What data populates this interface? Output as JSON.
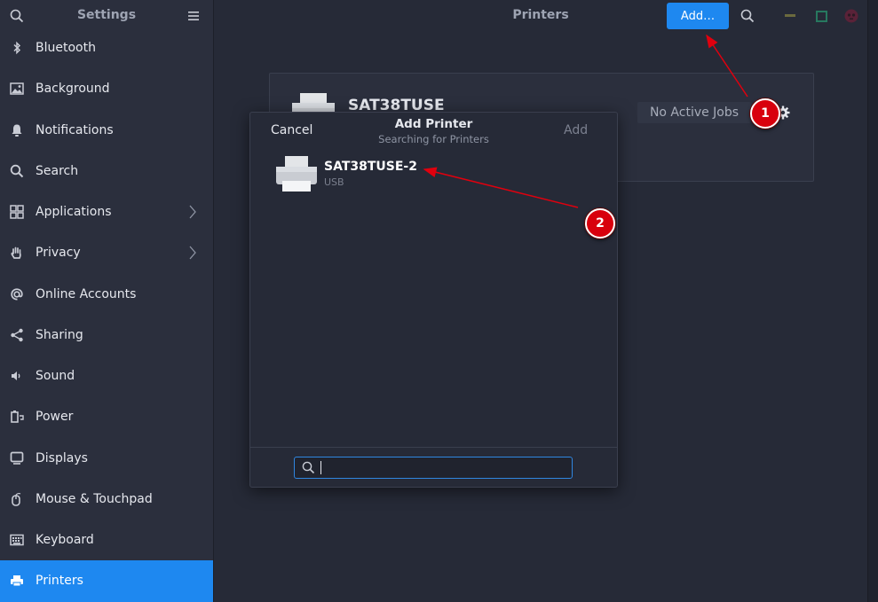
{
  "sidebar": {
    "title": "Settings",
    "search_icon": "search-icon",
    "menu_icon": "hamburger-menu-icon",
    "items": [
      {
        "label": "Bluetooth",
        "icon": "bluetooth-icon"
      },
      {
        "label": "Background",
        "icon": "image-icon"
      },
      {
        "label": "Notifications",
        "icon": "bell-icon"
      },
      {
        "label": "Search",
        "icon": "search-icon"
      },
      {
        "label": "Applications",
        "icon": "grid-icon",
        "has_submenu": true
      },
      {
        "label": "Privacy",
        "icon": "hand-icon",
        "has_submenu": true
      },
      {
        "label": "Online Accounts",
        "icon": "at-sign-icon"
      },
      {
        "label": "Sharing",
        "icon": "share-icon"
      },
      {
        "label": "Sound",
        "icon": "speaker-icon"
      },
      {
        "label": "Power",
        "icon": "power-icon"
      },
      {
        "label": "Displays",
        "icon": "monitor-icon"
      },
      {
        "label": "Mouse & Touchpad",
        "icon": "mouse-icon"
      },
      {
        "label": "Keyboard",
        "icon": "keyboard-icon"
      },
      {
        "label": "Printers",
        "icon": "printer-icon",
        "active": true
      }
    ]
  },
  "header": {
    "title": "Printers",
    "add_label": "Add…"
  },
  "printer_card": {
    "name": "SAT38TUSE",
    "status": "No Active Jobs"
  },
  "dialog": {
    "title": "Add Printer",
    "subtitle": "Searching for Printers",
    "cancel_label": "Cancel",
    "add_label": "Add",
    "items": [
      {
        "name": "SAT38TUSE-2",
        "connection": "USB"
      }
    ],
    "search_value": "",
    "search_placeholder": ""
  },
  "annotations": [
    {
      "label": "1"
    },
    {
      "label": "2"
    }
  ],
  "colors": {
    "accent": "#1e88f0",
    "annotation": "#d8000d"
  }
}
